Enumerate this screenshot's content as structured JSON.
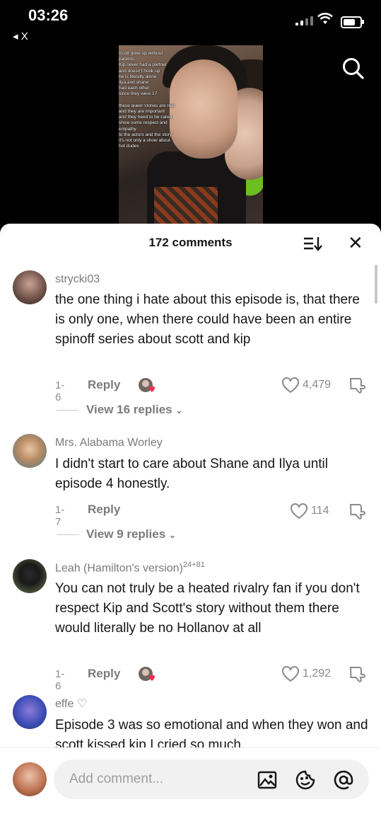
{
  "status_bar": {
    "time": "03:26",
    "back_label": "◂ X"
  },
  "video": {
    "overlay_text": "Scott grew up without\nparents\nKip never had a partner\nand doesn't hook up\nhe is literally alone\nIlya and shane\nhad each other\nsince they were 17\n\nthese queer stories are real\nand they are important\nand they need to be cared\nshow some respect and\nempathy\nto the actors and the story\nit's not only a show about\nhot dudes"
  },
  "comments_sheet": {
    "count_label": "172 comments",
    "comments": [
      {
        "username": "strycki03",
        "text": "the one thing i hate about this episode is, that there is only one, when there could have been an entire spinoff series about scott and kip",
        "date": "1-6",
        "reply_label": "Reply",
        "likes": "4,479",
        "view_replies": "View 16 replies"
      },
      {
        "username": "Mrs. Alabama Worley",
        "text": "I didn't start to care about Shane and Ilya until episode 4 honestly.",
        "date": "1-7",
        "reply_label": "Reply",
        "likes": "114",
        "view_replies": "View 9 replies"
      },
      {
        "username": "Leah (Hamilton's version)",
        "badge_a": "24",
        "badge_b": "+81",
        "text": "You can not truly be a heated rivalry fan if you don't respect Kip and Scott's story without them there would literally be no Hollanov at all",
        "date": "1-6",
        "reply_label": "Reply",
        "likes": "1,292"
      },
      {
        "username": "effe ♡",
        "text": "Episode 3 was so emotional and when they won and scott kissed kip I cried so much,"
      }
    ]
  },
  "composer": {
    "placeholder": "Add comment..."
  }
}
